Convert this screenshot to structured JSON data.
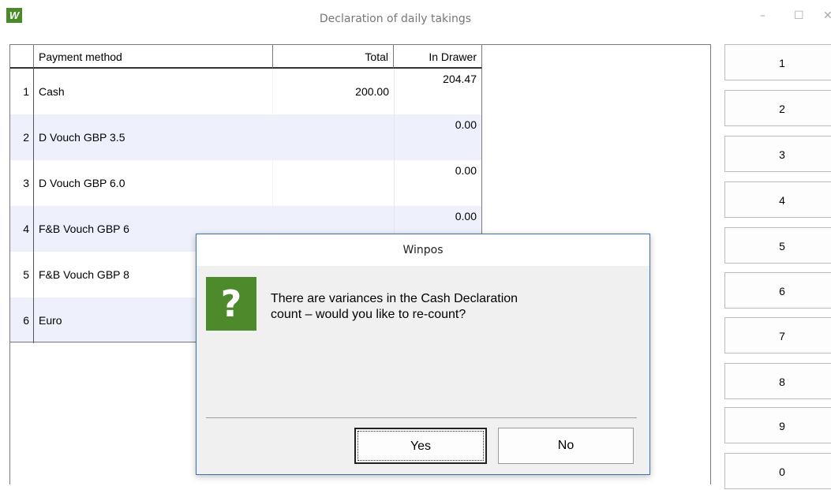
{
  "window": {
    "title": "Declaration of daily takings",
    "app_icon": "W",
    "minimize_glyph": "–",
    "maximize_glyph": "☐",
    "close_glyph": "✕"
  },
  "grid": {
    "headers": {
      "index": "",
      "method": "Payment method",
      "total": "Total",
      "drawer": "In Drawer"
    },
    "rows": [
      {
        "index": "1",
        "method": "Cash",
        "total": "200.00",
        "drawer": "204.47"
      },
      {
        "index": "2",
        "method": "D Vouch GBP 3.5",
        "total": "",
        "drawer": "0.00"
      },
      {
        "index": "3",
        "method": "D Vouch GBP 6.0",
        "total": "",
        "drawer": "0.00"
      },
      {
        "index": "4",
        "method": "F&B Vouch GBP 6",
        "total": "",
        "drawer": "0.00"
      },
      {
        "index": "5",
        "method": "F&B Vouch GBP 8",
        "total": "",
        "drawer": ""
      },
      {
        "index": "6",
        "method": "Euro",
        "total": "",
        "drawer": ""
      }
    ]
  },
  "keypad": {
    "keys": [
      "1",
      "2",
      "3",
      "4",
      "5",
      "6",
      "7",
      "8",
      "9",
      "0"
    ]
  },
  "dialog": {
    "title": "Winpos",
    "icon": "question-icon",
    "icon_glyph": "?",
    "message_line1": "There are variances in the Cash Declaration",
    "message_line2": "count – would you like to re-count?",
    "yes_label": "Yes",
    "no_label": "No"
  },
  "colors": {
    "brand_green": "#4c8a2b",
    "alt_row": "#eef1fc",
    "dialog_border": "#3d6fb3"
  }
}
